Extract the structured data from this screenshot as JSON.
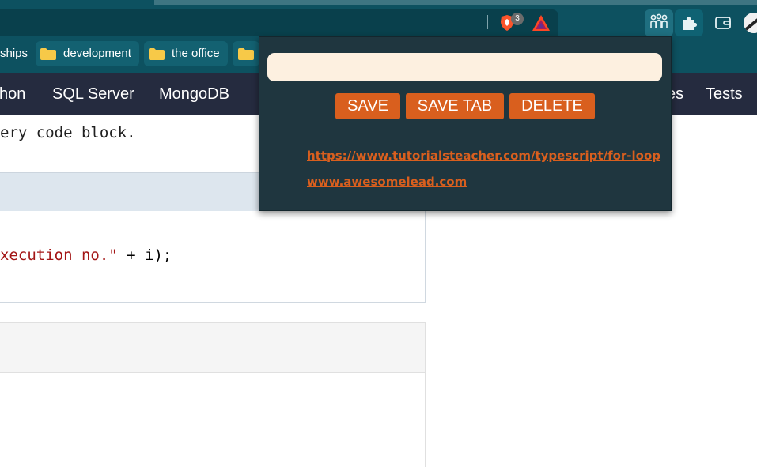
{
  "browser": {
    "brave_shields_count": "3",
    "colors": {
      "toolbar": "#0d5160",
      "omnibox": "#09404c"
    },
    "icons": [
      "brave-shields-icon",
      "brave-rewards-icon",
      "people-extension-icon",
      "extensions-puzzle-icon",
      "wallet-icon",
      "profile-avatar"
    ]
  },
  "bookmarks": [
    {
      "label": "ships"
    },
    {
      "label": "development"
    },
    {
      "label": "the office"
    },
    {
      "label": ""
    }
  ],
  "site_nav": {
    "items": [
      "hon",
      "SQL Server",
      "MongoDB",
      "es",
      "Tests"
    ],
    "bg_color": "#252b3f"
  },
  "page": {
    "intro_text": "ery code block.",
    "code_line_string": "xecution no.\"",
    "code_line_rest": " + i);"
  },
  "popup": {
    "input_value": "",
    "buttons": {
      "save": "SAVE",
      "save_tab": "SAVE TAB",
      "delete": "DELETE"
    },
    "links": [
      "https://www.tutorialsteacher.com/typescript/for-loop",
      "www.awesomelead.com"
    ],
    "colors": {
      "background": "#1f363f",
      "accent": "#d95f1e",
      "input_bg": "#fdf0e0"
    }
  }
}
